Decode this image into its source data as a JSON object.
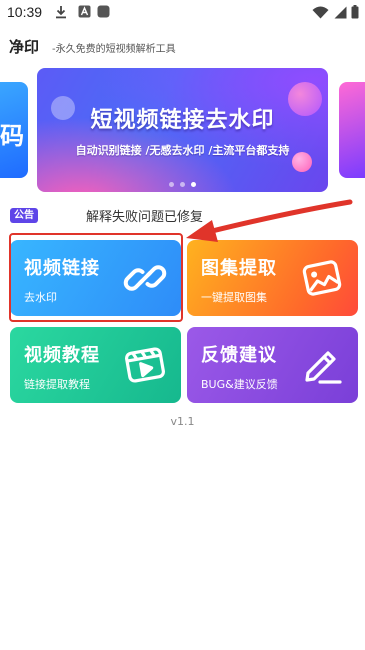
{
  "status_bar": {
    "time": "10:39"
  },
  "header": {
    "title": "净印",
    "subtitle": "-永久免费的短视频解析工具"
  },
  "banner": {
    "left_card_char": "码",
    "title": "短视频链接去水印",
    "subtitle": "自动识别链接 /无感去水印 /主流平台都支持",
    "dots_total": 3,
    "active_dot": 3
  },
  "notice": {
    "badge": "公告",
    "text": "解释失败问题已修复"
  },
  "cards": [
    {
      "title": "视频链接",
      "subtitle": "去水印",
      "icon": "link-icon"
    },
    {
      "title": "图集提取",
      "subtitle": "一键提取图集",
      "icon": "image-icon"
    },
    {
      "title": "视频教程",
      "subtitle": "链接提取教程",
      "icon": "video-play-icon"
    },
    {
      "title": "反馈建议",
      "subtitle": "BUG&建议反馈",
      "icon": "pen-icon"
    }
  ],
  "version": "v1.1",
  "colors": {
    "accent": "#5e45e8",
    "highlight_red": "#e0342a",
    "card_blue": "#2e8cf8",
    "card_orange": "#ff6a2a",
    "card_green": "#16b88e",
    "card_purple": "#7a3fd8"
  }
}
